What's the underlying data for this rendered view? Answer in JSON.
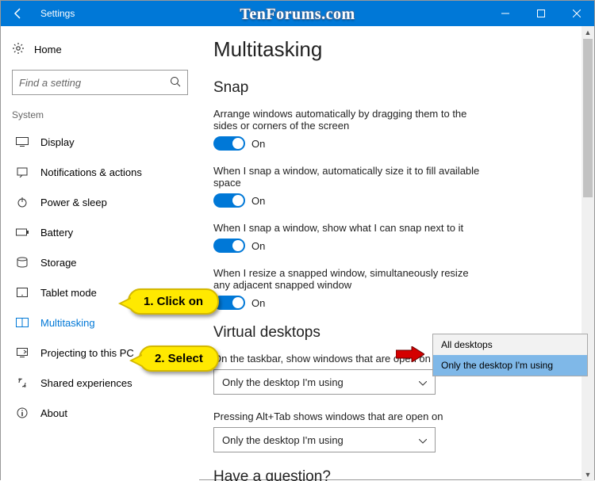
{
  "titlebar": {
    "title": "Settings"
  },
  "watermark": "TenForums.com",
  "sidebar": {
    "home": "Home",
    "search_placeholder": "Find a setting",
    "group": "System",
    "items": [
      {
        "label": "Display"
      },
      {
        "label": "Notifications & actions"
      },
      {
        "label": "Power & sleep"
      },
      {
        "label": "Battery"
      },
      {
        "label": "Storage"
      },
      {
        "label": "Tablet mode"
      },
      {
        "label": "Multitasking"
      },
      {
        "label": "Projecting to this PC"
      },
      {
        "label": "Shared experiences"
      },
      {
        "label": "About"
      }
    ]
  },
  "content": {
    "title": "Multitasking",
    "snap_heading": "Snap",
    "snap1": "Arrange windows automatically by dragging them to the sides or corners of the screen",
    "snap2": "When I snap a window, automatically size it to fill available space",
    "snap3": "When I snap a window, show what I can snap next to it",
    "snap4": "When I resize a snapped window, simultaneously resize any adjacent snapped window",
    "on": "On",
    "vd_heading": "Virtual desktops",
    "vd1_label": "On the taskbar, show windows that are open on",
    "vd1_value": "Only the desktop I'm using",
    "vd2_label": "Pressing Alt+Tab shows windows that are open on",
    "vd2_value": "Only the desktop I'm using",
    "question_heading": "Have a question?"
  },
  "popup": {
    "opt1": "All desktops",
    "opt2": "Only the desktop I'm using"
  },
  "callouts": {
    "c1": "1. Click on",
    "c2": "2. Select"
  }
}
